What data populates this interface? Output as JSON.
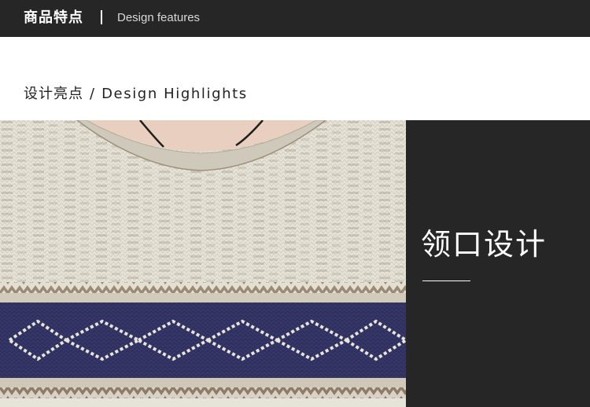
{
  "header": {
    "title_cn": "商品特点",
    "title_en": "Design features"
  },
  "section": {
    "title_cn": "设计亮点",
    "slash": "/",
    "title_en": "Design Highlights"
  },
  "detail": {
    "label_cn": "领口设计"
  },
  "colors": {
    "header_bg": "#262626",
    "panel_bg": "#262626",
    "knit_cream": "#e6e3d8",
    "knit_beige": "#a99a84",
    "knit_navy": "#2e2f63"
  }
}
